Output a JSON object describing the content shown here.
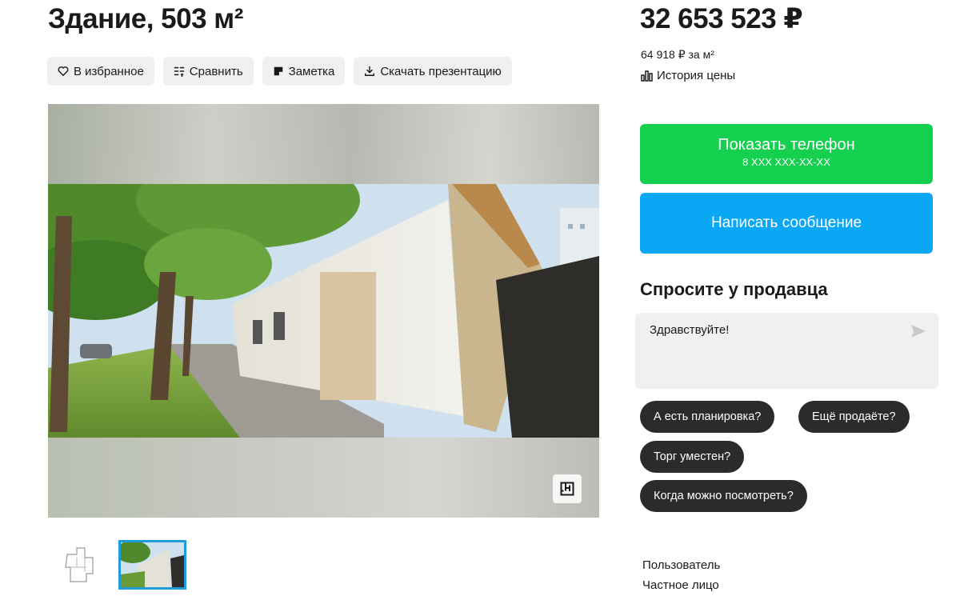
{
  "header": {
    "title": "Здание, 503 м²",
    "price": "32 653 523 ₽",
    "price_per_m2": "64 918 ₽ за м²",
    "price_history": "История цены"
  },
  "actions": [
    {
      "label": "В избранное",
      "icon": "heart-icon"
    },
    {
      "label": "Сравнить",
      "icon": "compare-icon"
    },
    {
      "label": "Заметка",
      "icon": "note-icon"
    },
    {
      "label": "Скачать презентацию",
      "icon": "download-icon"
    }
  ],
  "gallery": {
    "thumbnails": [
      "floorplan",
      "facade-photo"
    ],
    "active_index": 1
  },
  "contact": {
    "show_phone_label": "Показать телефон",
    "phone_mask": "8 XXX XXX-XX-XX",
    "write_message_label": "Написать сообщение"
  },
  "ask": {
    "title": "Спросите у продавца",
    "message": "Здравствуйте!",
    "chips": [
      "А есть планировка?",
      "Ещё продаёте?",
      "Торг уместен?",
      "Когда можно посмотреть?"
    ]
  },
  "seller": {
    "name": "Пользователь",
    "type": "Частное лицо"
  },
  "colors": {
    "phone_button": "#15cf4f",
    "message_button": "#0aa7f5",
    "chip_bg": "#2b2b2b",
    "active_thumb_border": "#1e9bdc"
  }
}
